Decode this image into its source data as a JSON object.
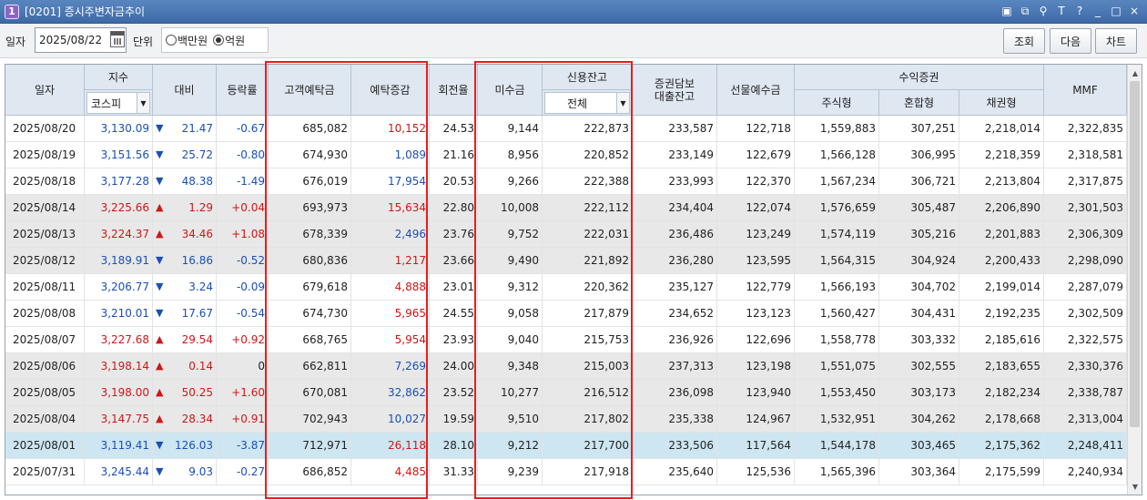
{
  "window": {
    "title": "[0201] 증시주변자금추이",
    "badge": "1"
  },
  "title_icons": [
    "screen-icon",
    "restore-icon",
    "pin-icon",
    "text-size-icon",
    "help-icon",
    "minimize-icon",
    "maximize-icon",
    "close-icon"
  ],
  "title_icon_glyphs": [
    "▣",
    "⧉",
    "⚲",
    "T",
    "?",
    "_",
    "□",
    "×"
  ],
  "toolbar": {
    "date_label": "일자",
    "date_value": "2025/08/22",
    "unit_label": "단위",
    "unit_options": [
      "백만원",
      "억원"
    ],
    "unit_selected": "억원",
    "buttons": {
      "query": "조회",
      "next": "다음",
      "chart": "차트"
    }
  },
  "headers": {
    "date": "일자",
    "index": "지수",
    "index_select": "코스피",
    "change": "대비",
    "rate": "등락률",
    "deposit": "고객예탁금",
    "deposit_change": "예탁증감",
    "turnover": "회전율",
    "receivable": "미수금",
    "credit": "신용잔고",
    "credit_select": "전체",
    "collateral_line1": "증권담보",
    "collateral_line2": "대출잔고",
    "futures": "선물예수금",
    "beneficiary": "수익증권",
    "stock": "주식형",
    "mixed": "혼합형",
    "bond": "채권형",
    "mmf": "MMF"
  },
  "rows": [
    {
      "date": "2025/08/20",
      "index": "3,130.09",
      "dir": "down",
      "change": "21.47",
      "rate": "-0.67",
      "deposit": "685,082",
      "deposit_change": "10,152",
      "deposit_dir": "up",
      "turnover": "24.53",
      "receivable": "9,144",
      "credit": "222,873",
      "collateral": "233,587",
      "futures": "122,718",
      "stock": "1,559,883",
      "mixed": "307,251",
      "bond": "2,218,014",
      "mmf": "2,322,835",
      "style": ""
    },
    {
      "date": "2025/08/19",
      "index": "3,151.56",
      "dir": "down",
      "change": "25.72",
      "rate": "-0.80",
      "deposit": "674,930",
      "deposit_change": "1,089",
      "deposit_dir": "down",
      "turnover": "21.16",
      "receivable": "8,956",
      "credit": "220,852",
      "collateral": "233,149",
      "futures": "122,679",
      "stock": "1,566,128",
      "mixed": "306,995",
      "bond": "2,218,359",
      "mmf": "2,318,581",
      "style": ""
    },
    {
      "date": "2025/08/18",
      "index": "3,177.28",
      "dir": "down",
      "change": "48.38",
      "rate": "-1.49",
      "deposit": "676,019",
      "deposit_change": "17,954",
      "deposit_dir": "down",
      "turnover": "20.53",
      "receivable": "9,266",
      "credit": "222,388",
      "collateral": "233,993",
      "futures": "122,370",
      "stock": "1,567,234",
      "mixed": "306,721",
      "bond": "2,213,804",
      "mmf": "2,317,875",
      "style": ""
    },
    {
      "date": "2025/08/14",
      "index": "3,225.66",
      "dir": "up",
      "change": "1.29",
      "rate": "+0.04",
      "deposit": "693,973",
      "deposit_change": "15,634",
      "deposit_dir": "up",
      "turnover": "22.80",
      "receivable": "10,008",
      "credit": "222,112",
      "collateral": "234,404",
      "futures": "122,074",
      "stock": "1,576,659",
      "mixed": "305,487",
      "bond": "2,206,890",
      "mmf": "2,301,503",
      "style": "shade"
    },
    {
      "date": "2025/08/13",
      "index": "3,224.37",
      "dir": "up",
      "change": "34.46",
      "rate": "+1.08",
      "deposit": "678,339",
      "deposit_change": "2,496",
      "deposit_dir": "down",
      "turnover": "23.76",
      "receivable": "9,752",
      "credit": "222,031",
      "collateral": "236,486",
      "futures": "123,249",
      "stock": "1,574,119",
      "mixed": "305,216",
      "bond": "2,201,883",
      "mmf": "2,306,309",
      "style": "shade"
    },
    {
      "date": "2025/08/12",
      "index": "3,189.91",
      "dir": "down",
      "change": "16.86",
      "rate": "-0.52",
      "deposit": "680,836",
      "deposit_change": "1,217",
      "deposit_dir": "up",
      "turnover": "23.66",
      "receivable": "9,490",
      "credit": "221,892",
      "collateral": "236,280",
      "futures": "123,595",
      "stock": "1,564,315",
      "mixed": "304,924",
      "bond": "2,200,433",
      "mmf": "2,298,090",
      "style": "shade"
    },
    {
      "date": "2025/08/11",
      "index": "3,206.77",
      "dir": "down",
      "change": "3.24",
      "rate": "-0.09",
      "deposit": "679,618",
      "deposit_change": "4,888",
      "deposit_dir": "up",
      "turnover": "23.01",
      "receivable": "9,312",
      "credit": "220,362",
      "collateral": "235,127",
      "futures": "122,779",
      "stock": "1,566,193",
      "mixed": "304,702",
      "bond": "2,199,014",
      "mmf": "2,287,079",
      "style": ""
    },
    {
      "date": "2025/08/08",
      "index": "3,210.01",
      "dir": "down",
      "change": "17.67",
      "rate": "-0.54",
      "deposit": "674,730",
      "deposit_change": "5,965",
      "deposit_dir": "up",
      "turnover": "24.55",
      "receivable": "9,058",
      "credit": "217,879",
      "collateral": "234,652",
      "futures": "123,123",
      "stock": "1,560,427",
      "mixed": "304,431",
      "bond": "2,192,235",
      "mmf": "2,302,509",
      "style": ""
    },
    {
      "date": "2025/08/07",
      "index": "3,227.68",
      "dir": "up",
      "change": "29.54",
      "rate": "+0.92",
      "deposit": "668,765",
      "deposit_change": "5,954",
      "deposit_dir": "up",
      "turnover": "23.93",
      "receivable": "9,040",
      "credit": "215,753",
      "collateral": "236,926",
      "futures": "122,696",
      "stock": "1,558,778",
      "mixed": "303,332",
      "bond": "2,185,616",
      "mmf": "2,322,575",
      "style": ""
    },
    {
      "date": "2025/08/06",
      "index": "3,198.14",
      "dir": "up",
      "change": "0.14",
      "rate": "0",
      "deposit": "662,811",
      "deposit_change": "7,269",
      "deposit_dir": "down",
      "turnover": "24.00",
      "receivable": "9,348",
      "credit": "215,003",
      "collateral": "237,313",
      "futures": "123,198",
      "stock": "1,551,075",
      "mixed": "302,555",
      "bond": "2,183,655",
      "mmf": "2,330,376",
      "style": "shade"
    },
    {
      "date": "2025/08/05",
      "index": "3,198.00",
      "dir": "up",
      "change": "50.25",
      "rate": "+1.60",
      "deposit": "670,081",
      "deposit_change": "32,862",
      "deposit_dir": "down",
      "turnover": "23.52",
      "receivable": "10,277",
      "credit": "216,512",
      "collateral": "236,098",
      "futures": "123,940",
      "stock": "1,553,450",
      "mixed": "303,173",
      "bond": "2,182,234",
      "mmf": "2,338,787",
      "style": "shade"
    },
    {
      "date": "2025/08/04",
      "index": "3,147.75",
      "dir": "up",
      "change": "28.34",
      "rate": "+0.91",
      "deposit": "702,943",
      "deposit_change": "10,027",
      "deposit_dir": "down",
      "turnover": "19.59",
      "receivable": "9,510",
      "credit": "217,802",
      "collateral": "235,338",
      "futures": "124,967",
      "stock": "1,532,951",
      "mixed": "304,262",
      "bond": "2,178,668",
      "mmf": "2,313,004",
      "style": "shade"
    },
    {
      "date": "2025/08/01",
      "index": "3,119.41",
      "dir": "down",
      "change": "126.03",
      "rate": "-3.87",
      "deposit": "712,971",
      "deposit_change": "26,118",
      "deposit_dir": "up",
      "turnover": "28.10",
      "receivable": "9,212",
      "credit": "217,700",
      "collateral": "233,506",
      "futures": "117,564",
      "stock": "1,544,178",
      "mixed": "303,465",
      "bond": "2,175,362",
      "mmf": "2,248,411",
      "style": "sel-row"
    },
    {
      "date": "2025/07/31",
      "index": "3,245.44",
      "dir": "down",
      "change": "9.03",
      "rate": "-0.27",
      "deposit": "686,852",
      "deposit_change": "4,485",
      "deposit_dir": "up",
      "turnover": "31.33",
      "receivable": "9,239",
      "credit": "217,918",
      "collateral": "235,640",
      "futures": "125,536",
      "stock": "1,565,396",
      "mixed": "303,364",
      "bond": "2,175,599",
      "mmf": "2,240,934",
      "style": ""
    }
  ],
  "colors": {
    "up": "#d01616",
    "down": "#1a4fb8",
    "highlight": "#e81e1e"
  }
}
